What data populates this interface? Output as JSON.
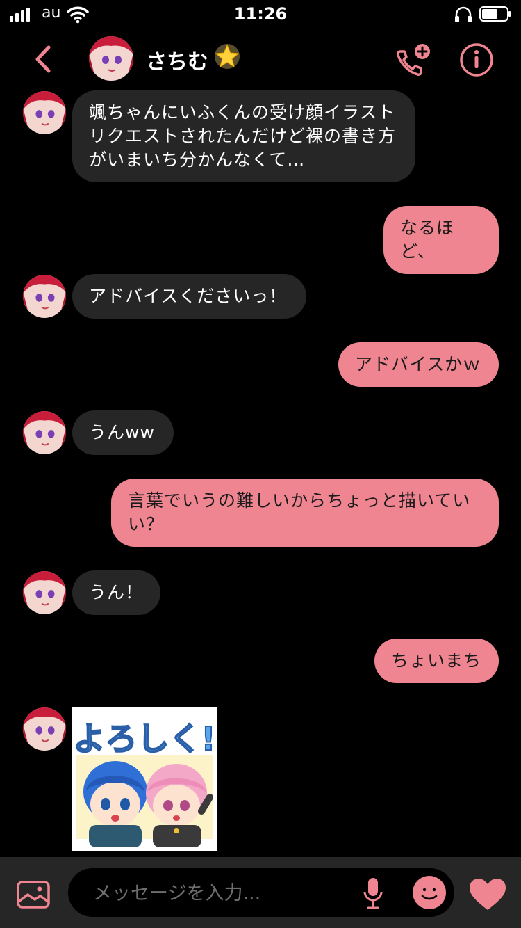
{
  "status_bar": {
    "carrier": "au",
    "time": "11:26"
  },
  "header": {
    "contact_name": "さちむ",
    "name_emoji": "star-icon"
  },
  "messages": [
    {
      "side": "incoming",
      "text": "颯ちゃんにいふくんの受け顔イラストリクエストされたんだけど裸の書き方がいまいち分かんなくて…"
    },
    {
      "side": "outgoing",
      "text": "なるほど、"
    },
    {
      "side": "incoming",
      "text": "アドバイスくださいっ！"
    },
    {
      "side": "outgoing",
      "text": "アドバイスかｗ"
    },
    {
      "side": "incoming",
      "text": "うんww"
    },
    {
      "side": "outgoing",
      "text": "言葉でいうの難しいからちょっと描いていい？"
    },
    {
      "side": "incoming",
      "text": "うん！"
    },
    {
      "side": "outgoing",
      "text": "ちょいまち"
    },
    {
      "side": "incoming",
      "type": "sticker",
      "sticker_text": "よろしく!"
    }
  ],
  "input": {
    "placeholder": "メッセージを入力..."
  },
  "colors": {
    "accent": "#ef8591",
    "incoming_bubble": "#262626",
    "background": "#000000"
  }
}
